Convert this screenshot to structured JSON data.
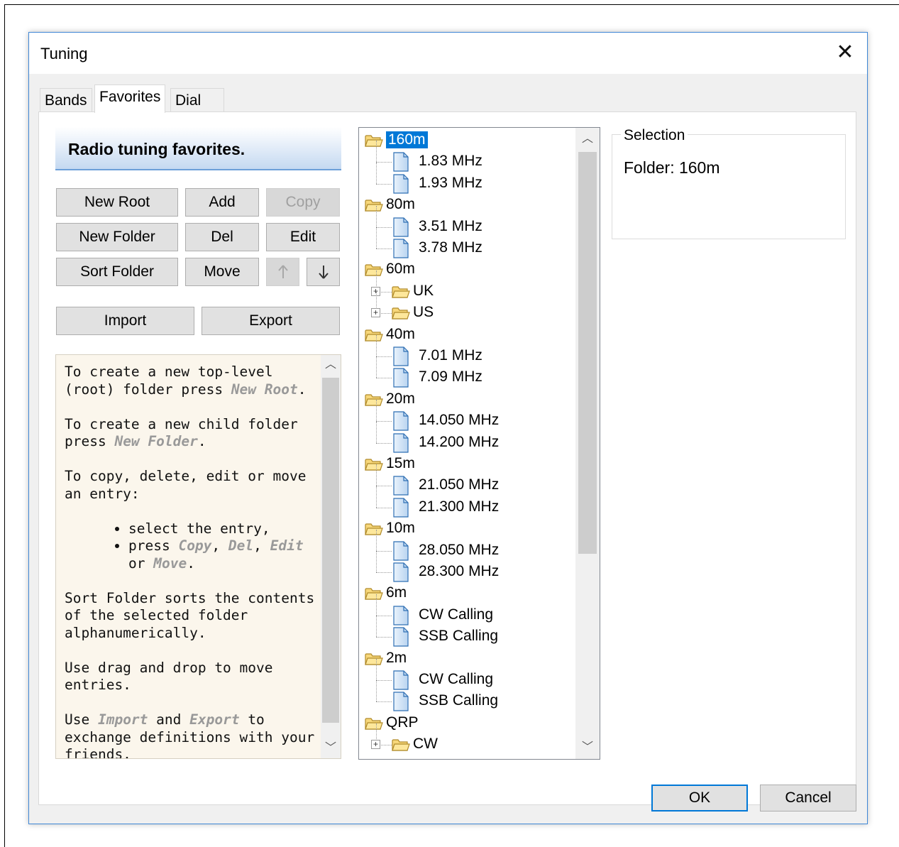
{
  "dialog": {
    "title": "Tuning",
    "close_glyph": "✕",
    "tabs": [
      {
        "label": "Bands"
      },
      {
        "label": "Favorites"
      },
      {
        "label": "Dial"
      }
    ],
    "ok_label": "OK",
    "cancel_label": "Cancel"
  },
  "favorites": {
    "header": "Radio tuning favorites.",
    "buttons": {
      "new_root": "New Root",
      "add": "Add",
      "copy": "Copy",
      "new_folder": "New Folder",
      "del": "Del",
      "edit": "Edit",
      "sort_folder": "Sort Folder",
      "move": "Move",
      "up_glyph": "🡑",
      "down_glyph": "🡓",
      "import": "Import",
      "export": "Export"
    },
    "help": {
      "p1_a": "To create a new top-level (root) folder press ",
      "p1_kw": "New Root",
      "p1_b": ".",
      "p2_a": "To create a new child folder press ",
      "p2_kw": "New Folder",
      "p2_b": ".",
      "p3": "To copy, delete, edit or move an entry:",
      "li1": "select the entry,",
      "li2_a": "press ",
      "li2_kw1": "Copy",
      "li2_sep1": ", ",
      "li2_kw2": "Del",
      "li2_sep2": ", ",
      "li2_kw3": "Edit",
      "li2_or": " or ",
      "li2_kw4": "Move",
      "li2_end": ".",
      "p4": "Sort Folder sorts the contents of the selected folder alphanumerically.",
      "p5": "Use drag and drop to move entries.",
      "p6_a": "Use ",
      "p6_kw1": "Import",
      "p6_mid": " and ",
      "p6_kw2": "Export",
      "p6_b": " to exchange definitions with your friends."
    },
    "tree": {
      "f160": "160m",
      "f160_1": "1.83 MHz",
      "f160_2": "1.93 MHz",
      "f80": "80m",
      "f80_1": "3.51 MHz",
      "f80_2": "3.78 MHz",
      "f60": "60m",
      "f60_uk": "UK",
      "f60_us": "US",
      "f40": "40m",
      "f40_1": "7.01 MHz",
      "f40_2": "7.09 MHz",
      "f20": "20m",
      "f20_1": "14.050 MHz",
      "f20_2": "14.200 MHz",
      "f15": "15m",
      "f15_1": "21.050 MHz",
      "f15_2": "21.300 MHz",
      "f10": "10m",
      "f10_1": "28.050 MHz",
      "f10_2": "28.300 MHz",
      "f6": "6m",
      "f6_1": "CW Calling",
      "f6_2": "SSB Calling",
      "f2": "2m",
      "f2_1": "CW Calling",
      "f2_2": "SSB Calling",
      "fqrp": "QRP",
      "fqrp_cw": "CW"
    },
    "selection": {
      "legend": "Selection",
      "text": "Folder: 160m"
    }
  }
}
